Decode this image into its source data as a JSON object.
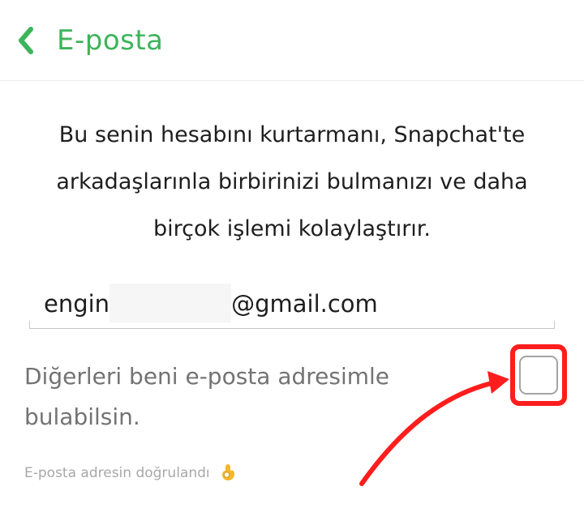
{
  "header": {
    "title": "E-posta",
    "back_icon": "chevron-left-icon",
    "accent_color": "#3db45a"
  },
  "description": {
    "lines": [
      "Bu senin hesabını kurtarmanı, Snapchat'te",
      "arkadaşlarınla birbirinizi bulmanızı ve daha",
      "birçok işlemi kolaylaştırır."
    ]
  },
  "email_field": {
    "value_prefix": "engin",
    "value_suffix": "@gmail.com"
  },
  "discover_option": {
    "lines": [
      "Diğerleri beni e-posta adresimle",
      "bulabilsin."
    ],
    "checked": false
  },
  "verified": {
    "text": "E-posta adresin doğrulandı",
    "icon": "ok-hand-icon"
  },
  "annotation": {
    "color": "#ff1d1d"
  }
}
